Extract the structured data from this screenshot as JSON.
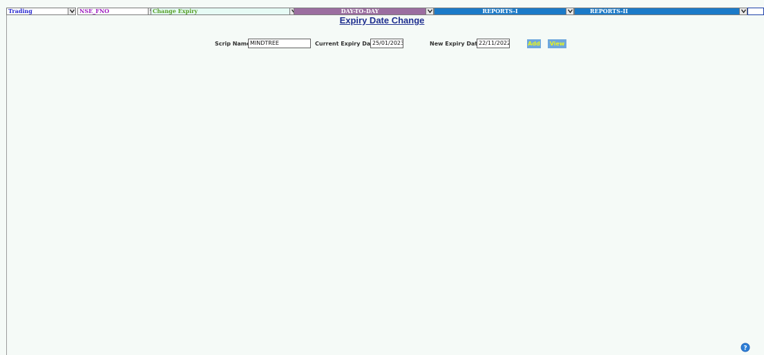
{
  "menubar": {
    "app_select": "Trading",
    "segment_select": "NSE_FNO",
    "function_select": "Change Expiry",
    "day_to_day": "DAY-TO-DAY",
    "reports_1": "REPORTS-I",
    "reports_2": "REPORTS-II"
  },
  "title": "Expiry Date Change",
  "form": {
    "scrip_label": "Scrip Name:",
    "scrip_value": "MINDTREE",
    "current_expiry_label": "Current Expiry Date:",
    "current_expiry_value": "25/01/2023",
    "new_expiry_label": "New Expiry Date:",
    "new_expiry_value": "22/11/2022",
    "add_label": "Add",
    "view_label": "View"
  },
  "help_icon": "question-icon",
  "colors": {
    "background": "#f5faf7",
    "title": "#1f2f8f",
    "day_to_day_bg": "#9b6ea0",
    "reports_bg": "#1b7ac8",
    "button_bg": "#6ea7dd",
    "button_text": "#e9f51e",
    "trading_text": "#2a2ad0",
    "segment_text": "#a020c0",
    "function_text": "#5aa02a",
    "function_bg": "#e6fbf5"
  }
}
